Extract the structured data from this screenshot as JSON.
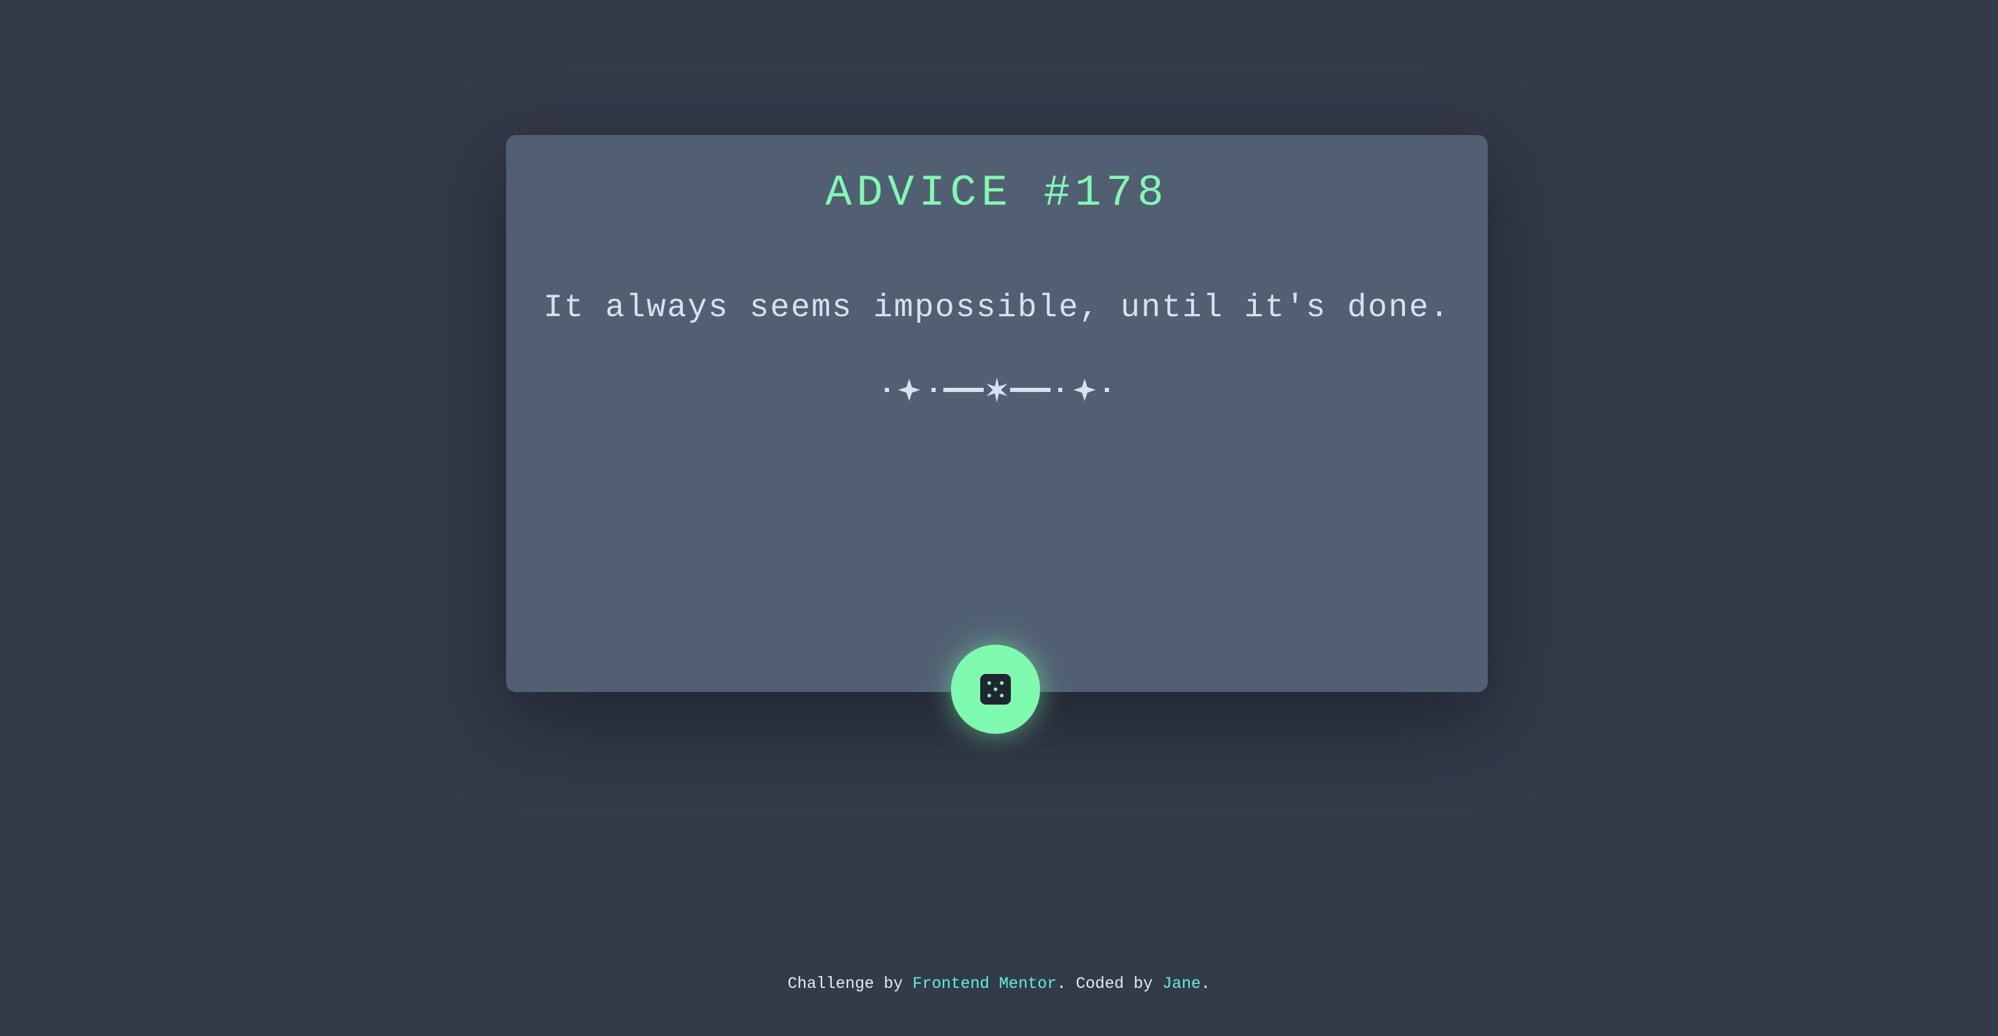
{
  "card": {
    "advice_id": "ADVICE #178",
    "quote": "It always seems impossible, until it's done."
  },
  "button": {
    "icon": "dice-icon"
  },
  "footer": {
    "prefix": "Challenge by ",
    "frontend_link": "Frontend Mentor",
    "middle": ". Coded by ",
    "author_link": "Jane",
    "suffix": "."
  },
  "colors": {
    "background": "#333a48",
    "card": "#525f73",
    "accent": "#7ffbb0",
    "text": "#d8e2ef",
    "link": "#5cf0e0"
  }
}
